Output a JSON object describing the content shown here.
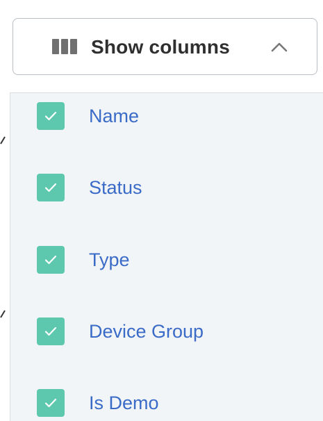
{
  "colors": {
    "checkbox_fill": "#5dc8ae",
    "option_text": "#3a6bc7",
    "button_text": "#2f2f2f",
    "panel_background": "#f2f5f8"
  },
  "toggle": {
    "label": "Show columns",
    "icon": "columns-icon",
    "chevron": "chevron-up-icon",
    "expanded": true
  },
  "columns": [
    {
      "label": "Name",
      "checked": true
    },
    {
      "label": "Status",
      "checked": true
    },
    {
      "label": "Type",
      "checked": true
    },
    {
      "label": "Device Group",
      "checked": true
    },
    {
      "label": "Is Demo",
      "checked": true
    }
  ]
}
